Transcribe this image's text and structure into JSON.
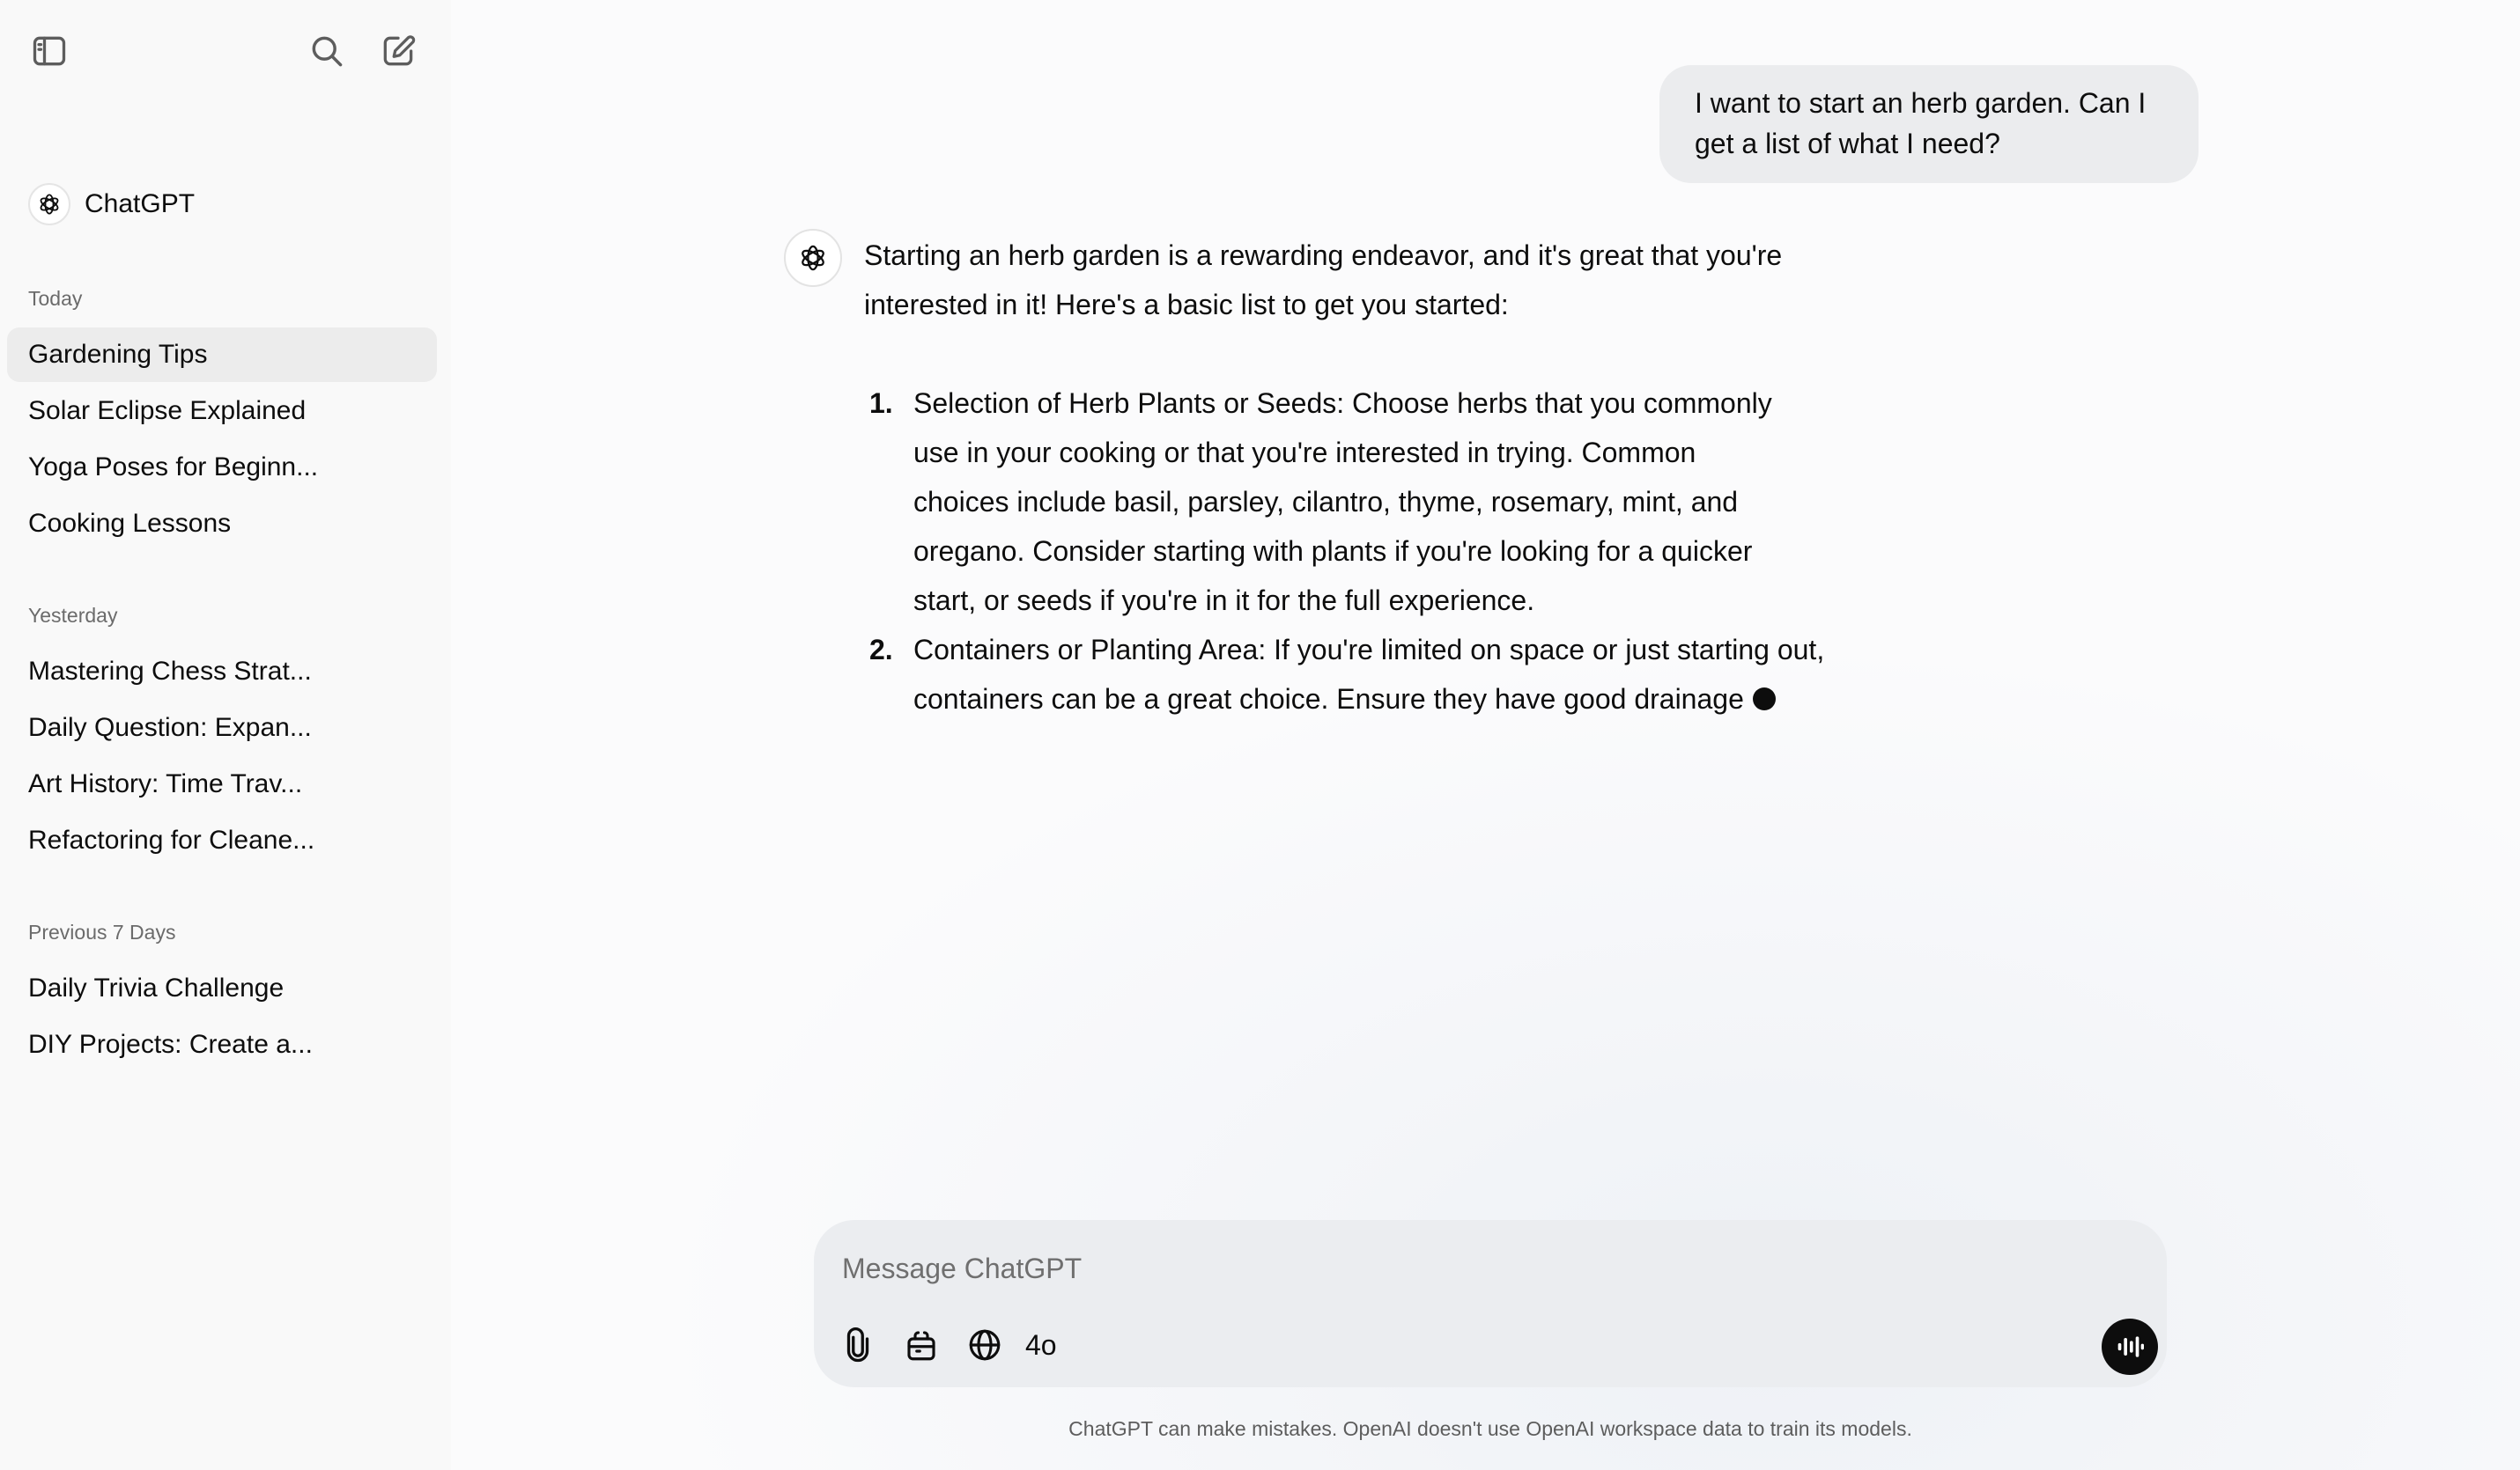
{
  "sidebar": {
    "toggle_icon": "sidebar-toggle-icon",
    "search_icon": "search-icon",
    "new_chat_icon": "new-chat-icon",
    "brand": {
      "name": "ChatGPT",
      "icon": "openai-logo-icon"
    },
    "groups": [
      {
        "label": "Today",
        "items": [
          {
            "label": "Gardening Tips",
            "active": true
          },
          {
            "label": "Solar Eclipse Explained"
          },
          {
            "label": "Yoga Poses for Beginn..."
          },
          {
            "label": "Cooking Lessons"
          }
        ]
      },
      {
        "label": "Yesterday",
        "items": [
          {
            "label": "Mastering Chess Strat..."
          },
          {
            "label": "Daily Question: Expan..."
          },
          {
            "label": "Art History: Time Trav..."
          },
          {
            "label": "Refactoring for Cleane..."
          }
        ]
      },
      {
        "label": "Previous 7 Days",
        "items": [
          {
            "label": "Daily Trivia Challenge"
          },
          {
            "label": "DIY Projects: Create a..."
          }
        ]
      }
    ]
  },
  "conversation": {
    "user_message": "I want to start an herb garden. Can I get a list of what I need?",
    "assistant": {
      "intro": "Starting an herb garden is a rewarding endeavor, and it's great that you're interested in it! Here's a basic list to get you started:",
      "items": [
        {
          "num": "1.",
          "text": "Selection of Herb Plants or Seeds: Choose herbs that you commonly use in your cooking or that you're interested in trying. Common choices include basil, parsley, cilantro, thyme, rosemary, mint, and oregano. Consider starting with plants if you're looking for a quicker start, or seeds if you're in it for the full experience."
        },
        {
          "num": "2.",
          "text": "Containers or Planting Area: If you're limited on space or just starting out, containers can be a great choice. Ensure they have good drainage"
        }
      ]
    }
  },
  "composer": {
    "placeholder": "Message ChatGPT",
    "value": "",
    "model": "4o",
    "tools": [
      "paperclip-icon",
      "tools-icon",
      "globe-icon"
    ],
    "voice_icon": "voice-waveform-icon"
  },
  "footer": {
    "disclaimer": "ChatGPT can make mistakes. OpenAI doesn't use OpenAI workspace data to train its models."
  },
  "colors": {
    "sidebar_bg": "#f9f9f9",
    "active_item_bg": "#ececec",
    "bubble_bg": "#ebecee",
    "composer_bg": "#ebedf0",
    "voice_button": "#0d0d0d"
  }
}
